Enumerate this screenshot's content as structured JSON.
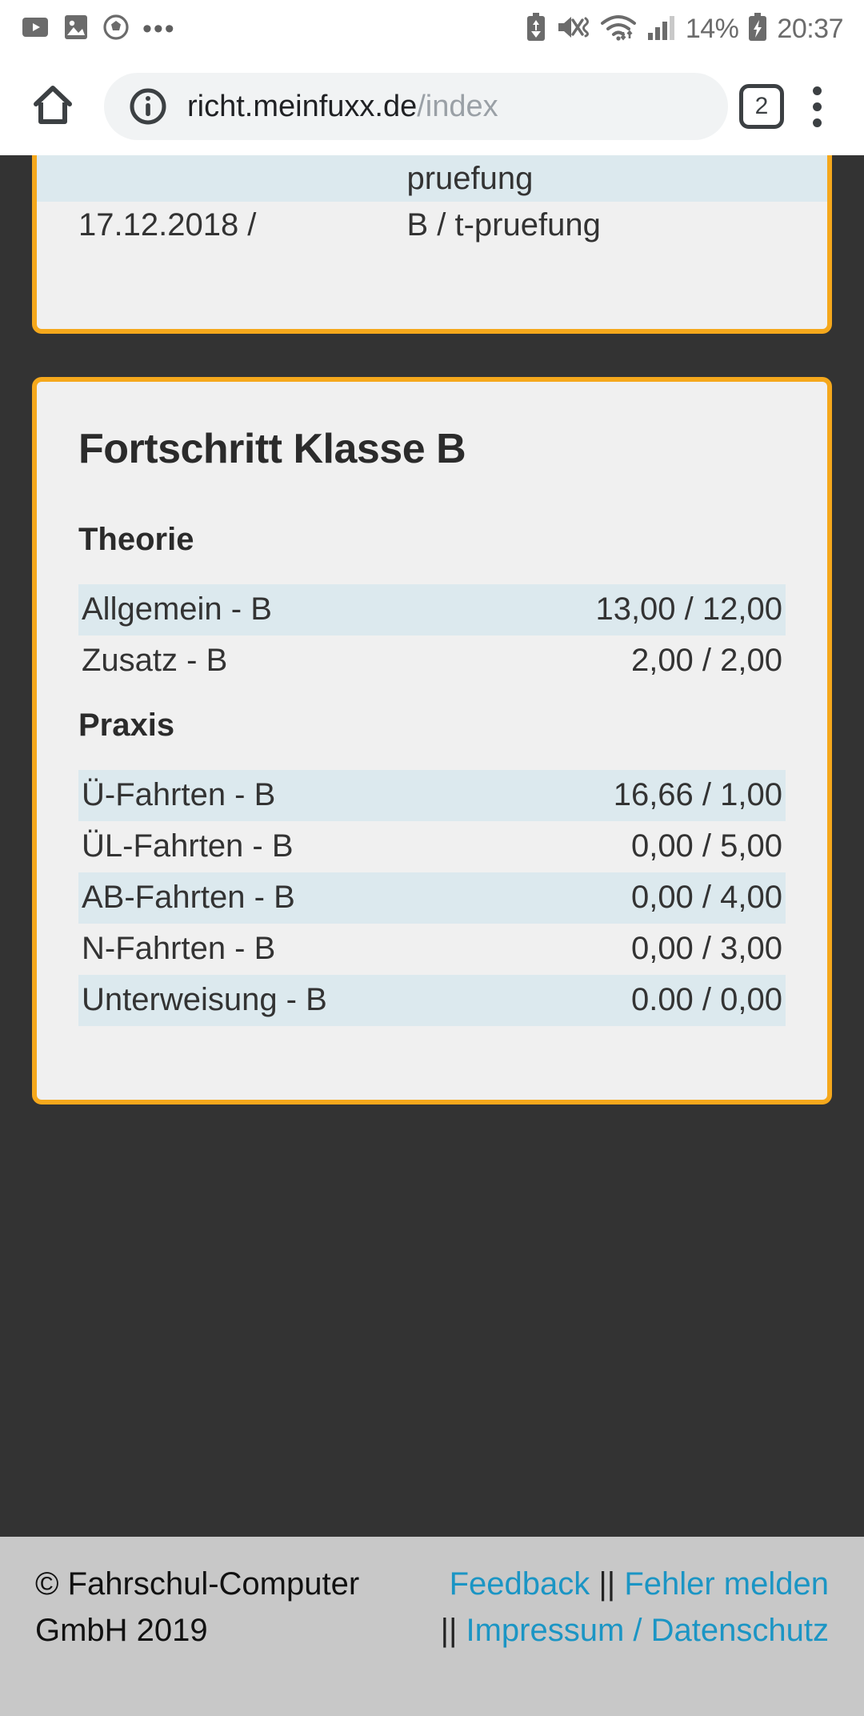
{
  "status_bar": {
    "notification_icons": [
      "youtube-icon",
      "image-icon",
      "football-icon",
      "more-dots-icon"
    ],
    "more_dots": "•••",
    "battery_percent": "14%",
    "time": "20:37",
    "right_icons": [
      "battery-saver-icon",
      "mute-vibrate-icon",
      "wifi-icon",
      "signal-icon",
      "charging-battery-icon"
    ]
  },
  "browser": {
    "home_label": "home-icon",
    "site_info_label": "site-info-icon",
    "url_host": "richt.meinfuxx.de",
    "url_path": "/index",
    "tab_count": "2",
    "menu_label": "overflow-menu-icon"
  },
  "top_card": {
    "rows": [
      {
        "date": "",
        "exam": "pruefung",
        "highlight": true
      },
      {
        "date": "17.12.2018 /",
        "exam": "B / t-pruefung",
        "highlight": false
      }
    ]
  },
  "progress_card": {
    "title": "Fortschritt Klasse B",
    "sections": [
      {
        "heading": "Theorie",
        "rows": [
          {
            "label": "Allgemein - B",
            "value": "13,00 / 12,00",
            "highlight": true
          },
          {
            "label": "Zusatz - B",
            "value": "2,00 / 2,00",
            "highlight": false
          }
        ]
      },
      {
        "heading": "Praxis",
        "rows": [
          {
            "label": "Ü-Fahrten - B",
            "value": "16,66 / 1,00",
            "highlight": true
          },
          {
            "label": "ÜL-Fahrten - B",
            "value": "0,00 / 5,00",
            "highlight": false
          },
          {
            "label": "AB-Fahrten - B",
            "value": "0,00 / 4,00",
            "highlight": true
          },
          {
            "label": "N-Fahrten - B",
            "value": "0,00 / 3,00",
            "highlight": false
          },
          {
            "label": "Unterweisung - B",
            "value": "0.00 / 0,00",
            "highlight": true
          }
        ]
      }
    ]
  },
  "footer": {
    "copyright": "© Fahrschul-Computer GmbH 2019",
    "links": [
      {
        "label": "Feedback"
      },
      {
        "label": "Fehler melden"
      },
      {
        "label": "Impressum / Datenschutz"
      }
    ],
    "separator": "||"
  },
  "colors": {
    "accent_orange": "#f5a81c",
    "card_bg": "#f0f0f0",
    "row_highlight": "#dce9ee",
    "page_bg": "#333333",
    "footer_bg": "#c8c8c8",
    "link_blue": "#1b95c4"
  }
}
